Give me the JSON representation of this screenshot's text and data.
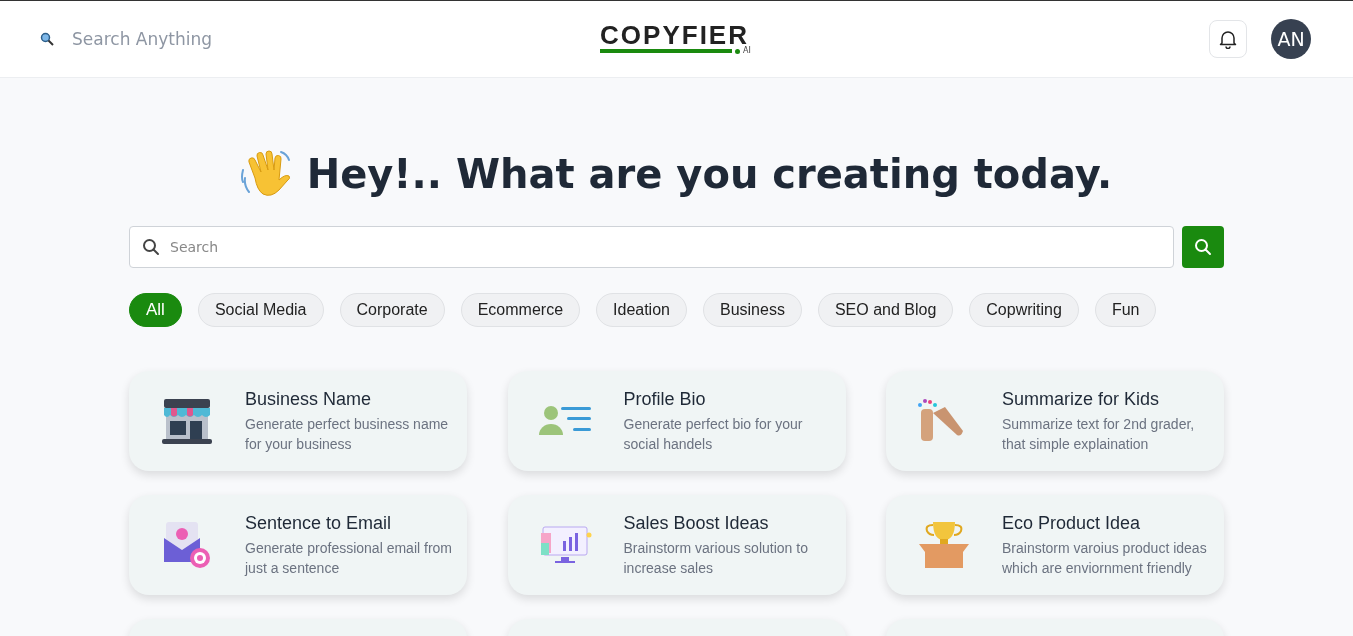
{
  "header": {
    "search_placeholder": "Search Anything",
    "logo": "COPYFIER",
    "logo_badge": "AI",
    "avatar_initials": "AN"
  },
  "heading": "Hey!.. What are you creating today.",
  "search": {
    "placeholder": "Search"
  },
  "categories": [
    {
      "label": "All",
      "selected": true
    },
    {
      "label": "Social Media",
      "selected": false
    },
    {
      "label": "Corporate",
      "selected": false
    },
    {
      "label": "Ecommerce",
      "selected": false
    },
    {
      "label": "Ideation",
      "selected": false
    },
    {
      "label": "Business",
      "selected": false
    },
    {
      "label": "SEO and Blog",
      "selected": false
    },
    {
      "label": "Copwriting",
      "selected": false
    },
    {
      "label": "Fun",
      "selected": false
    }
  ],
  "tools": [
    {
      "kind": "store",
      "title": "Business Name",
      "description": "Generate perfect business name for your business"
    },
    {
      "kind": "profile",
      "title": "Profile Bio",
      "description": "Generate perfect bio for your social handels"
    },
    {
      "kind": "hands",
      "title": "Summarize for Kids",
      "description": "Summarize text for 2nd grader, that simple explaination"
    },
    {
      "kind": "email",
      "title": "Sentence to Email",
      "description": "Generate professional email from just a sentence"
    },
    {
      "kind": "chart",
      "title": "Sales Boost Ideas",
      "description": "Brainstorm various solution to increase sales"
    },
    {
      "kind": "trophy",
      "title": "Eco Product Idea",
      "description": "Brainstorm varoius product ideas which are enviornment friendly"
    },
    {
      "kind": "blank"
    },
    {
      "kind": "blank"
    },
    {
      "kind": "blank"
    }
  ]
}
